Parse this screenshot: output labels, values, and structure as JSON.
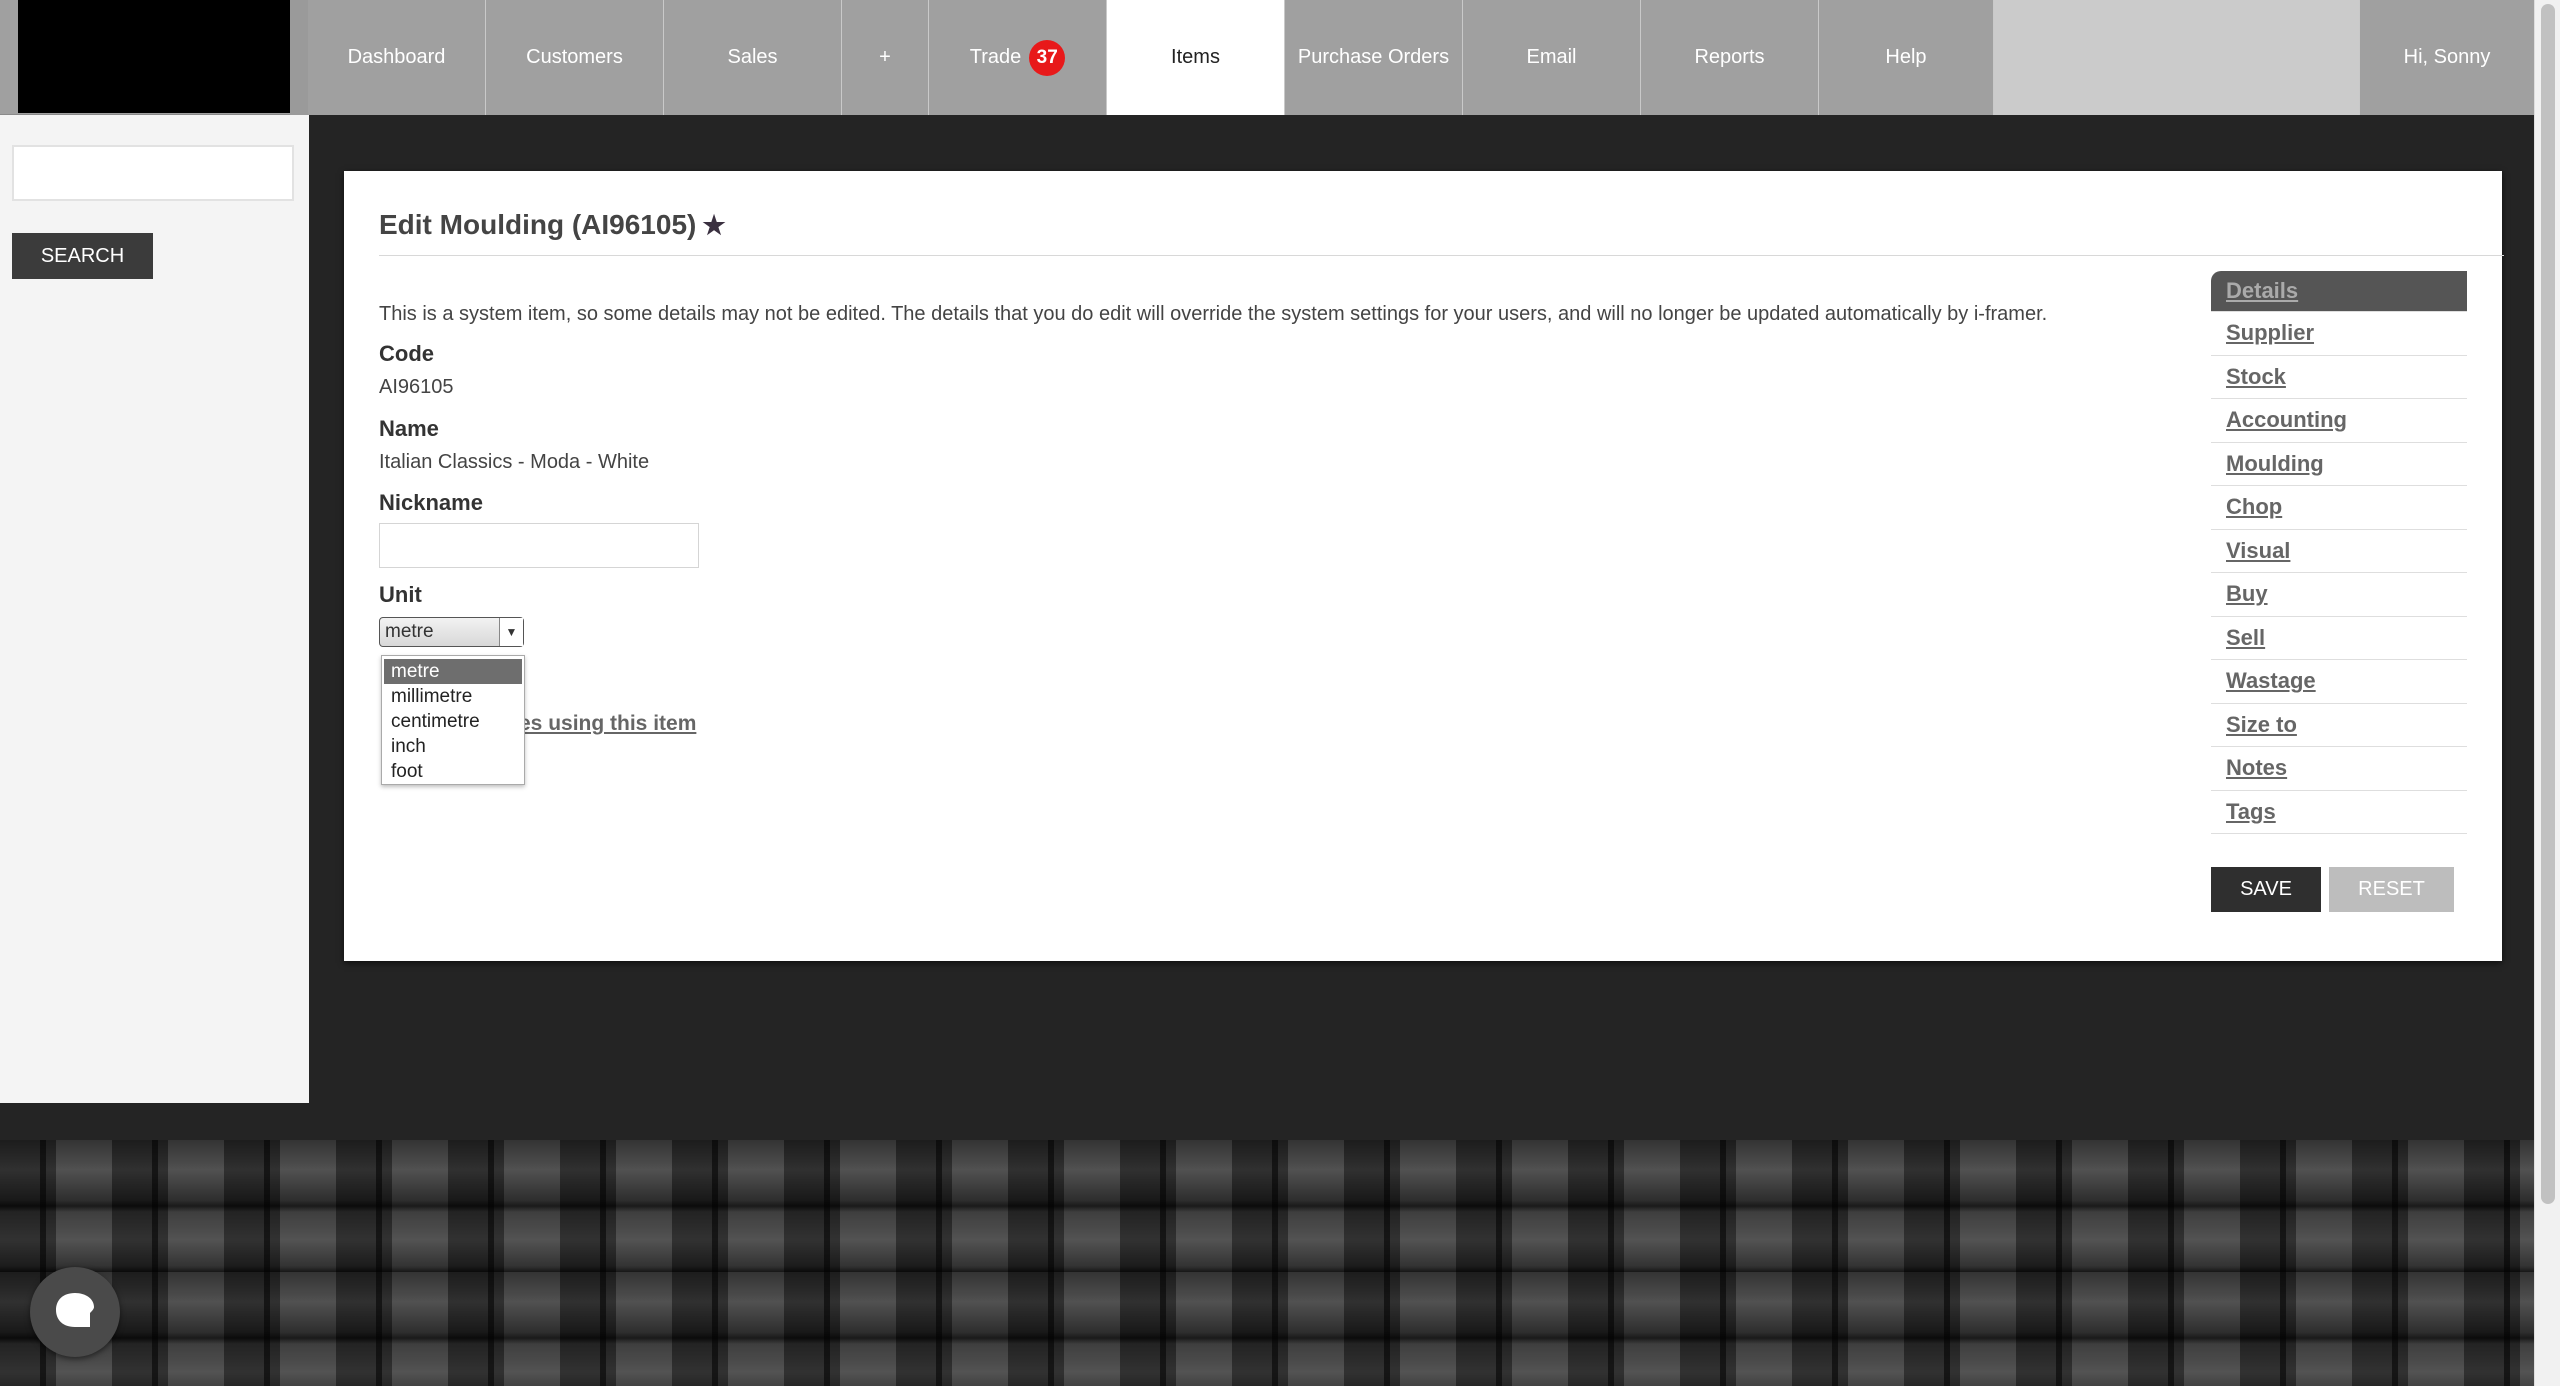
{
  "nav": {
    "items": [
      {
        "label": "Dashboard"
      },
      {
        "label": "Customers"
      },
      {
        "label": "Sales"
      },
      {
        "label": "+"
      },
      {
        "label": "Trade",
        "badge": "37"
      },
      {
        "label": "Items"
      },
      {
        "label": "Purchase Orders"
      },
      {
        "label": "Email"
      },
      {
        "label": "Reports"
      },
      {
        "label": "Help"
      }
    ],
    "active": "Items",
    "greeting": "Hi, Sonny"
  },
  "sidebar": {
    "search_placeholder": "",
    "search_button": "SEARCH"
  },
  "page": {
    "title": "Edit Moulding (AI96105)",
    "title_icon": "star-icon",
    "notice": "This is a system item, so some details may not be edited. The details that you do edit will override the system settings for your users, and will no longer be updated automatically by i-framer.",
    "code_label": "Code",
    "code_value": "AI96105",
    "name_label": "Name",
    "name_value": "Italian Classics - Moda - White",
    "nickname_label": "Nickname",
    "nickname_value": "",
    "unit_label": "Unit",
    "unit_value": "metre",
    "unit_options": [
      "metre",
      "millimetre",
      "centimetre",
      "inch",
      "foot"
    ],
    "related_link": "es using this item"
  },
  "side_tabs": [
    "Details",
    "Supplier",
    "Stock",
    "Accounting",
    "Moulding",
    "Chop",
    "Visual",
    "Buy",
    "Sell",
    "Wastage",
    "Size to",
    "Notes",
    "Tags"
  ],
  "actions": {
    "save": "SAVE",
    "reset": "RESET"
  },
  "colors": {
    "nav_bg": "#a0a0a0",
    "badge": "#e8191a",
    "page_bg": "#242424"
  }
}
